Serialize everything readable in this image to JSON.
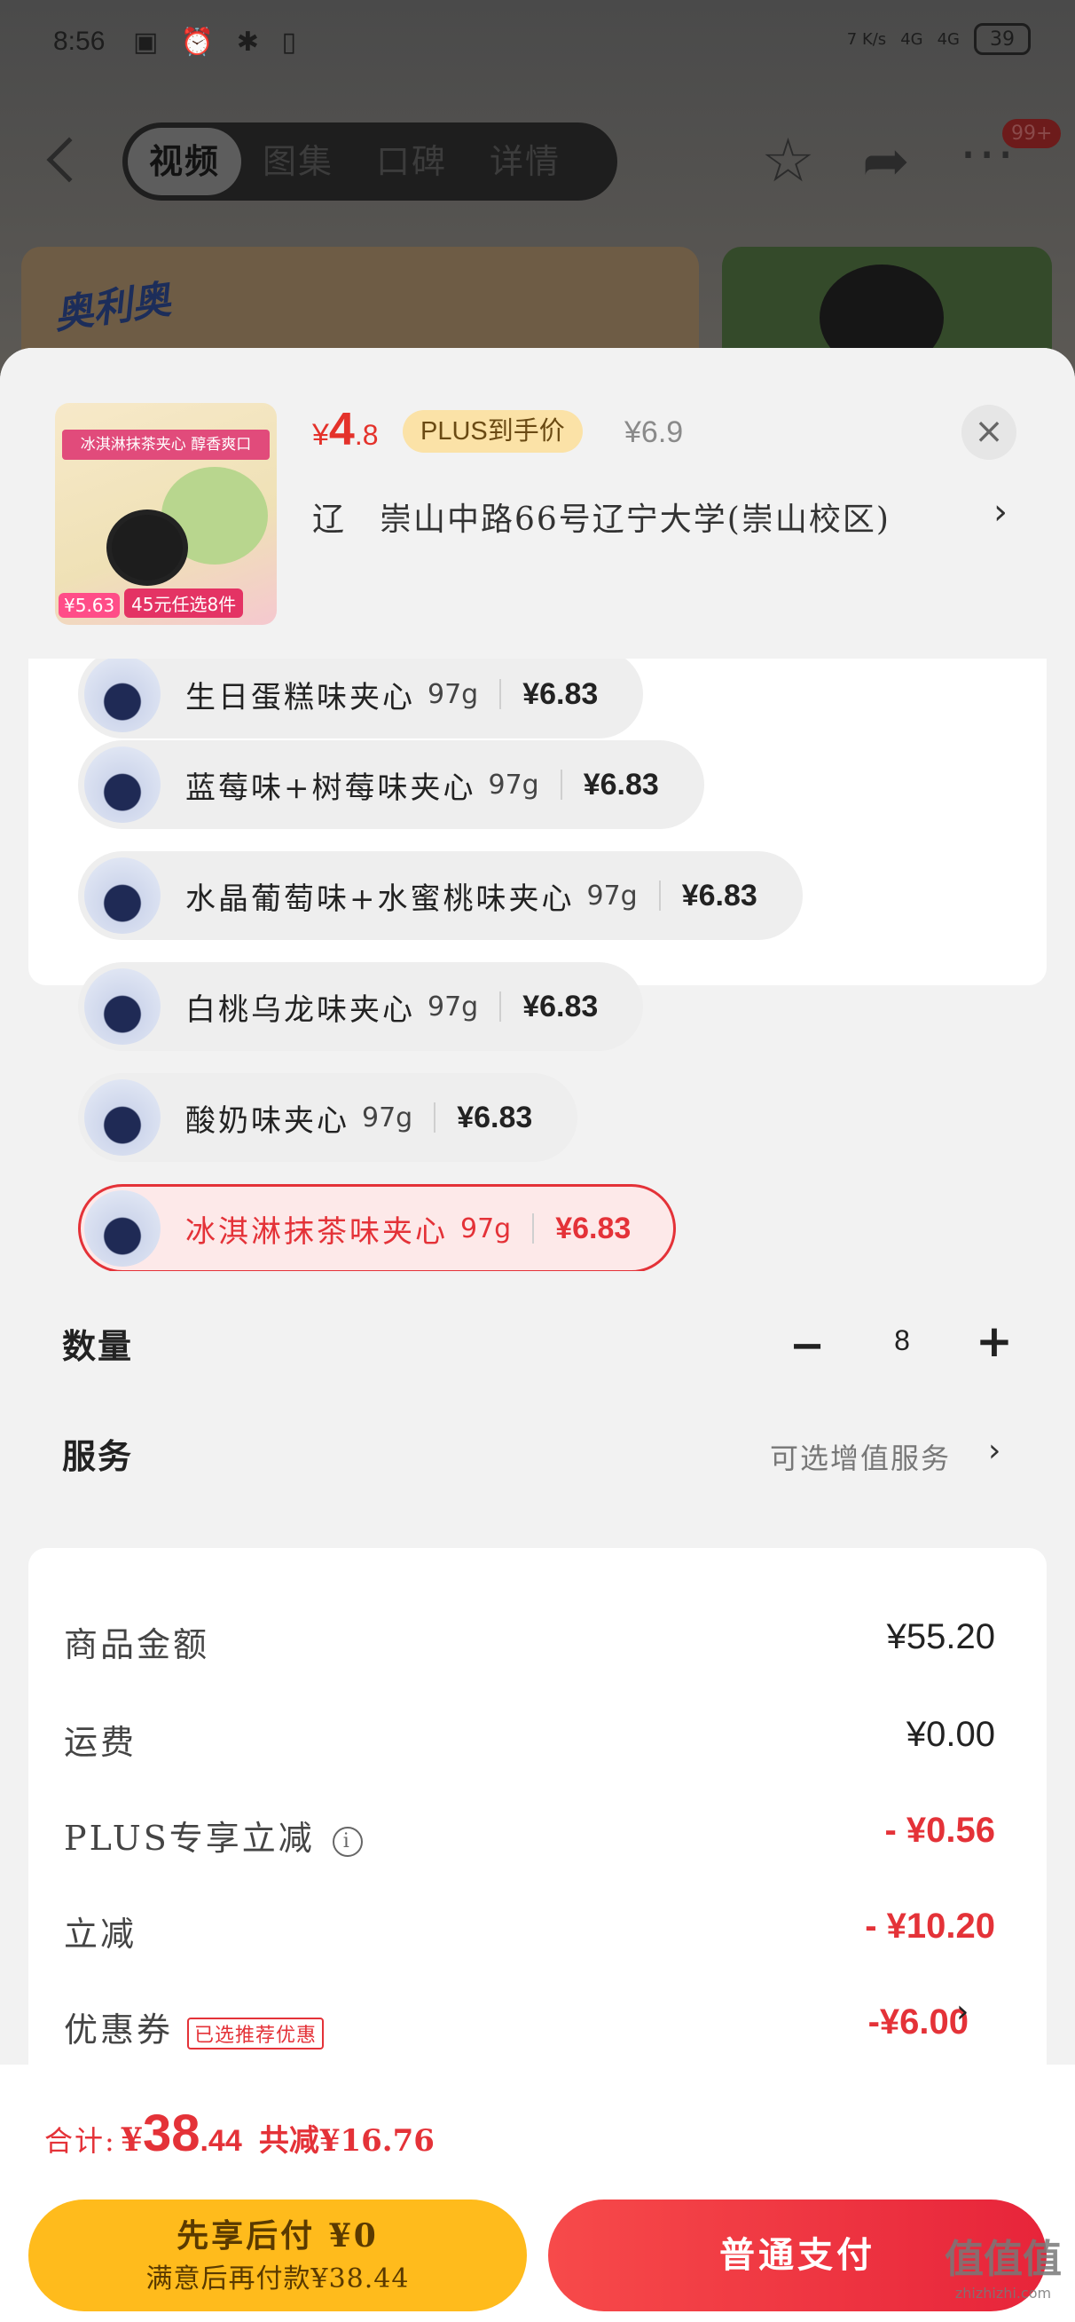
{
  "status_bar": {
    "time": "8:56",
    "network_speed": "7 K/s",
    "signal_1": "4G",
    "signal_2": "4G",
    "battery": "39"
  },
  "nav": {
    "tabs": [
      {
        "label": "视频",
        "active": true
      },
      {
        "label": "图集",
        "active": false
      },
      {
        "label": "口碑",
        "active": false
      },
      {
        "label": "详情",
        "active": false
      }
    ],
    "badge": "99+"
  },
  "banner": {
    "brand_logo": "奥利奥"
  },
  "product": {
    "image_title": "冰淇淋抹茶夹心 醇香爽口",
    "image_price": "¥5.63",
    "image_deal": "45元任选8件",
    "price_symbol": "¥",
    "price_int": "4",
    "price_dec": ".8",
    "plus_label": "PLUS到手价",
    "original_price": "¥6.9",
    "address": "辽　崇山中路66号辽宁大学(崇山校区)"
  },
  "flavors": [
    {
      "name": "生日蛋糕味夹心",
      "weight": "97g",
      "price": "¥6.83",
      "selected": false
    },
    {
      "name": "蓝莓味+树莓味夹心",
      "weight": "97g",
      "price": "¥6.83",
      "selected": false
    },
    {
      "name": "水晶葡萄味+水蜜桃味夹心",
      "weight": "97g",
      "price": "¥6.83",
      "selected": false
    },
    {
      "name": "白桃乌龙味夹心",
      "weight": "97g",
      "price": "¥6.83",
      "selected": false
    },
    {
      "name": "酸奶味夹心",
      "weight": "97g",
      "price": "¥6.83",
      "selected": false
    },
    {
      "name": "冰淇淋抹茶味夹心",
      "weight": "97g",
      "price": "¥6.83",
      "selected": true
    }
  ],
  "quantity": {
    "label": "数量",
    "minus": "−",
    "value": "8",
    "plus": "+"
  },
  "service": {
    "label": "服务",
    "hint": "可选增值服务",
    "chevron": "›"
  },
  "costs": {
    "goods_label": "商品金额",
    "goods_value": "¥55.20",
    "shipping_label": "运费",
    "shipping_value": "¥0.00",
    "plus_discount_label": "PLUS专享立减",
    "plus_discount_value": "- ¥0.56",
    "discount_label": "立减",
    "discount_value": "- ¥10.20",
    "coupon_label": "优惠券",
    "coupon_tag": "已选推荐优惠",
    "coupon_value": "-¥6.00"
  },
  "footer": {
    "total_label": "合计:",
    "total_symbol": "¥",
    "total_int": "38",
    "total_dec": ".44",
    "total_saving": "共减¥16.76",
    "pay_later_line1": "先享后付 ¥0",
    "pay_later_line2": "满意后再付款¥38.44",
    "pay_label": "普通支付"
  },
  "watermark": {
    "main": "值值值",
    "sub": "zhizhizhi.com"
  },
  "colors": {
    "accent_red": "#e43238",
    "plus_gold": "#fbe2a7",
    "pay_later_yellow": "#ffbb1c"
  }
}
